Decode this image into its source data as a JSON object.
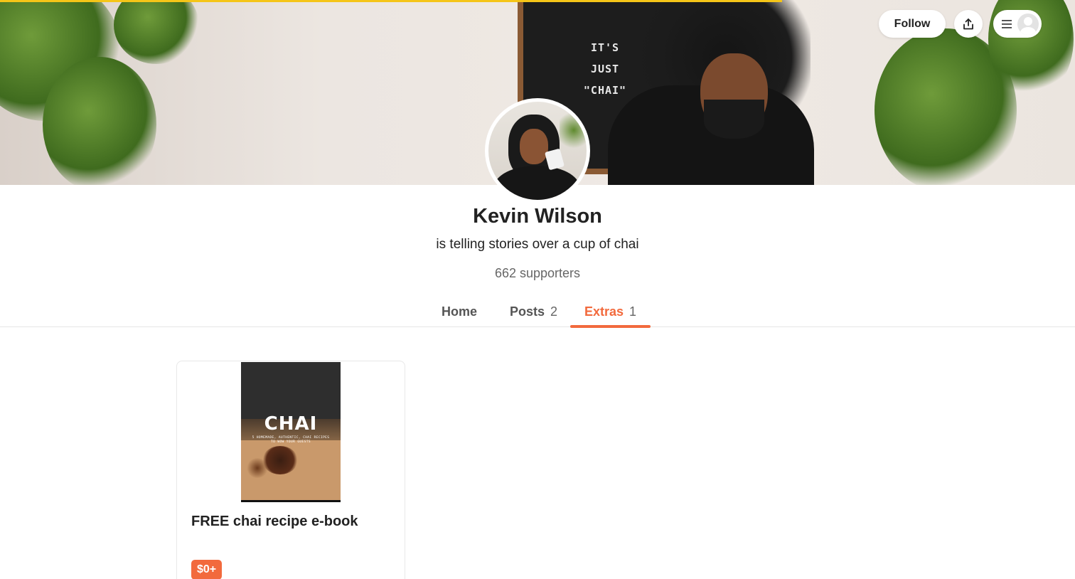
{
  "header": {
    "follow_label": "Follow",
    "share_icon": "share-icon",
    "menu_icon": "hamburger-menu-icon",
    "avatar_icon": "user-avatar-icon"
  },
  "cover": {
    "letterboard_lines": [
      "IT'S",
      "JUST",
      "\"CHAI\""
    ],
    "progress_color": "#f5c518"
  },
  "profile": {
    "name": "Kevin Wilson",
    "tagline": "is telling stories over a cup of chai",
    "supporters": "662 supporters"
  },
  "tabs": [
    {
      "label": "Home",
      "count": ""
    },
    {
      "label": "Posts",
      "count": "2"
    },
    {
      "label": "Extras",
      "count": "1",
      "active": true
    }
  ],
  "extras": [
    {
      "cover_title": "CHAI",
      "cover_subtitle": "5 HOMEMADE, AUTHENTIC, CHAI RECIPES TO WOW YOUR GUESTS",
      "title": "FREE chai recipe e-book",
      "price": "$0+"
    }
  ],
  "colors": {
    "accent": "#f26a3d",
    "text": "#222222",
    "muted": "#666666"
  }
}
